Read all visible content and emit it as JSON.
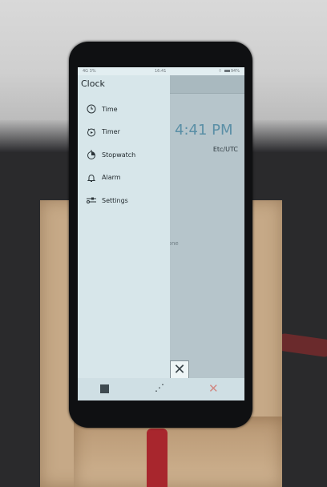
{
  "status_bar": {
    "signal": "4G 3%",
    "time": "16:41",
    "battery": "94%"
  },
  "drawer": {
    "title": "Clock",
    "items": [
      {
        "label": "Time",
        "icon": "clock-icon"
      },
      {
        "label": "Timer",
        "icon": "timer-icon"
      },
      {
        "label": "Stopwatch",
        "icon": "stopwatch-icon"
      },
      {
        "label": "Alarm",
        "icon": "bell-icon"
      },
      {
        "label": "Settings",
        "icon": "sliders-icon"
      }
    ]
  },
  "background_app": {
    "time": "4:41 PM",
    "zone": "Etc/UTC",
    "partial_label": "zone"
  },
  "navbar": {
    "close_glyph": "✕"
  },
  "colors": {
    "accent_time": "#5a8fa6",
    "drawer_bg": "#d7e6ea",
    "close_red": "#d18a85"
  }
}
